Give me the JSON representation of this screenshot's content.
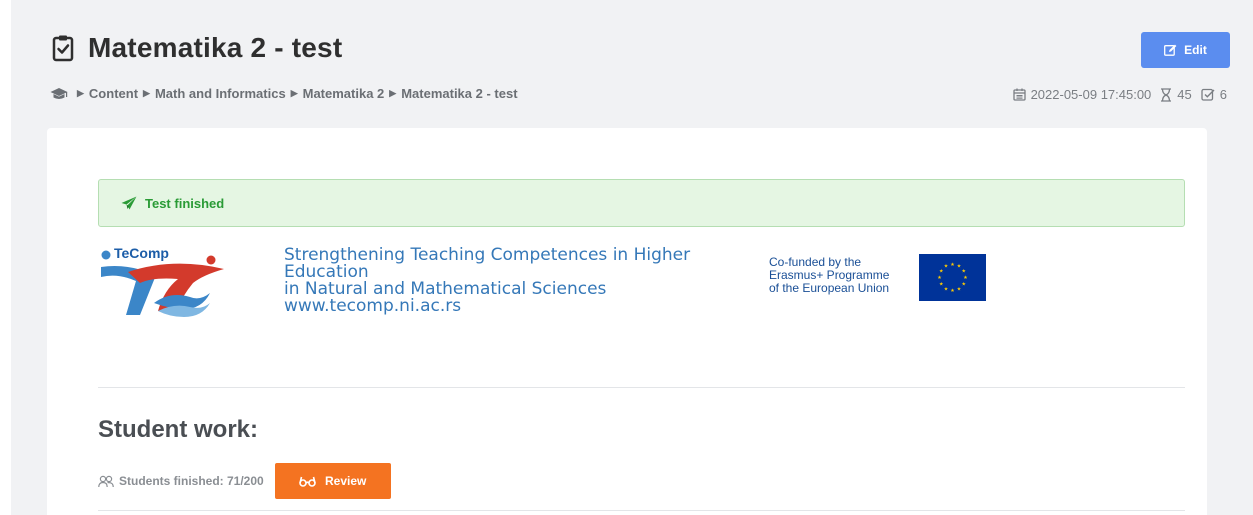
{
  "page": {
    "title": "Matematika 2 - test",
    "edit_label": "Edit"
  },
  "breadcrumb": {
    "items": [
      "Content",
      "Math and Informatics",
      "Matematika 2",
      "Matematika 2 - test"
    ]
  },
  "meta": {
    "datetime": "2022-05-09 17:45:00",
    "duration": "45",
    "questions": "6"
  },
  "alert": {
    "text": "Test finished"
  },
  "banner": {
    "logo_text": "TeComp",
    "project_lines": [
      "Strengthening Teaching Competences in Higher",
      "Education",
      "in Natural and Mathematical Sciences",
      "www.tecomp.ni.ac.rs"
    ],
    "erasmus_lines": [
      "Co-funded by the",
      "Erasmus+ Programme",
      "of the European Union"
    ]
  },
  "student_work": {
    "title": "Student work:",
    "finished_label": "Students finished: 71/200",
    "review_label": "Review"
  },
  "colors": {
    "edit_button": "#5b8def",
    "review_button": "#f47321",
    "alert_bg": "#e5f6e3",
    "alert_text": "#2a9b36",
    "eu_blue": "#003399",
    "eu_star": "#ffcc00"
  },
  "icons": {
    "title": "clipboard-check-icon",
    "breadcrumb_home": "graduation-cap-icon",
    "separator": "caret-right-icon",
    "date": "calendar-icon",
    "duration": "hourglass-icon",
    "questions": "check-square-icon",
    "edit": "edit-icon",
    "alert": "paper-plane-icon",
    "students": "users-icon",
    "review": "glasses-icon"
  }
}
